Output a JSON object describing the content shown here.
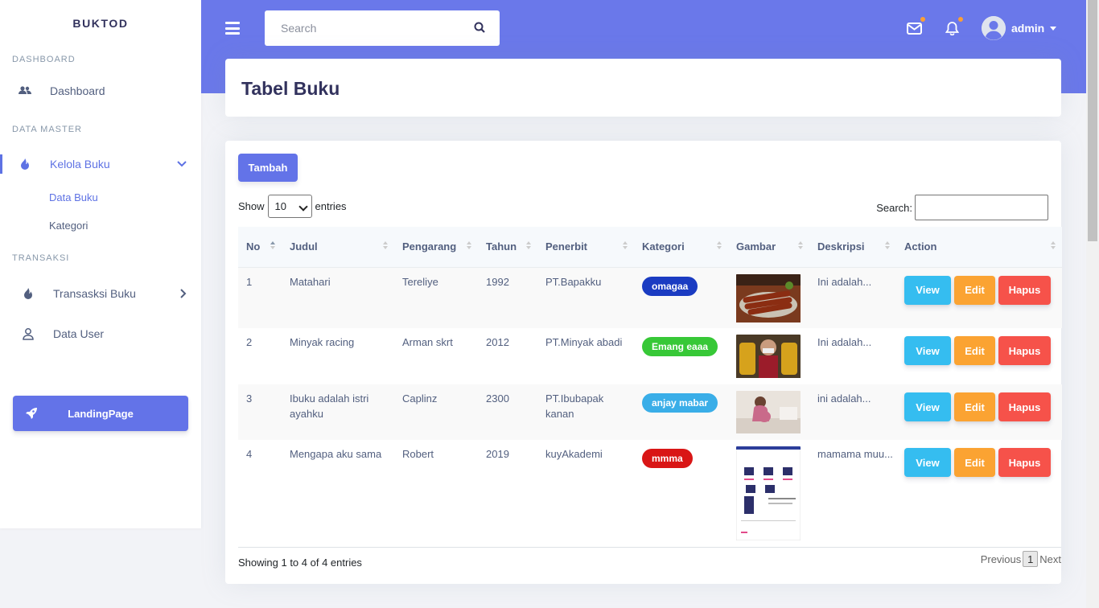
{
  "brand": "BUKTOD",
  "sidebar": {
    "sections": [
      {
        "heading": "DASHBOARD"
      },
      {
        "heading": "DATA MASTER"
      },
      {
        "heading": "TRANSAKSI"
      }
    ],
    "items": {
      "dashboard": "Dashboard",
      "kelola_buku": "Kelola Buku",
      "data_buku": "Data Buku",
      "kategori": "Kategori",
      "transaksi_buku": "Transasksi Buku",
      "data_user": "Data User"
    },
    "landing_button": "LandingPage"
  },
  "header": {
    "search_placeholder": "Search",
    "username": "admin"
  },
  "page_title": "Tabel Buku",
  "table": {
    "add_button": "Tambah",
    "show_label": "Show",
    "entries_label": "entries",
    "page_length": "10",
    "search_label": "Search:",
    "columns": [
      "No",
      "Judul",
      "Pengarang",
      "Tahun",
      "Penerbit",
      "Kategori",
      "Gambar",
      "Deskripsi",
      "Action"
    ],
    "rows": [
      {
        "no": "1",
        "judul": "Matahari",
        "pengarang": "Tereliye",
        "tahun": "1992",
        "penerbit": "PT.Bapakku",
        "kategori": "omagaa",
        "kategori_color": "#1b3cc2",
        "deskripsi": "Ini adalah..."
      },
      {
        "no": "2",
        "judul": "Minyak racing",
        "pengarang": "Arman skrt",
        "tahun": "2012",
        "penerbit": "PT.Minyak abadi",
        "kategori": "Emang eaaa",
        "kategori_color": "#37c837",
        "deskripsi": "Ini adalah..."
      },
      {
        "no": "3",
        "judul": "Ibuku adalah istri ayahku",
        "pengarang": "Caplinz",
        "tahun": "2300",
        "penerbit": "PT.Ibubapak kanan",
        "kategori": "anjay mabar",
        "kategori_color": "#3aaee8",
        "deskripsi": "ini adalah..."
      },
      {
        "no": "4",
        "judul": "Mengapa aku sama",
        "pengarang": "Robert",
        "tahun": "2019",
        "penerbit": "kuyAkademi",
        "kategori": "mmma",
        "kategori_color": "#d91616",
        "deskripsi": "mamama muu..."
      }
    ],
    "actions": {
      "view": "View",
      "edit": "Edit",
      "hapus": "Hapus"
    },
    "info": "Showing 1 to 4 of 4 entries",
    "pagination": {
      "previous": "Previous",
      "current": "1",
      "next": "Next"
    }
  },
  "colors": {
    "primary": "#6a78ea",
    "view": "#35bdf0",
    "edit": "#fba332",
    "hapus": "#f6524a"
  }
}
